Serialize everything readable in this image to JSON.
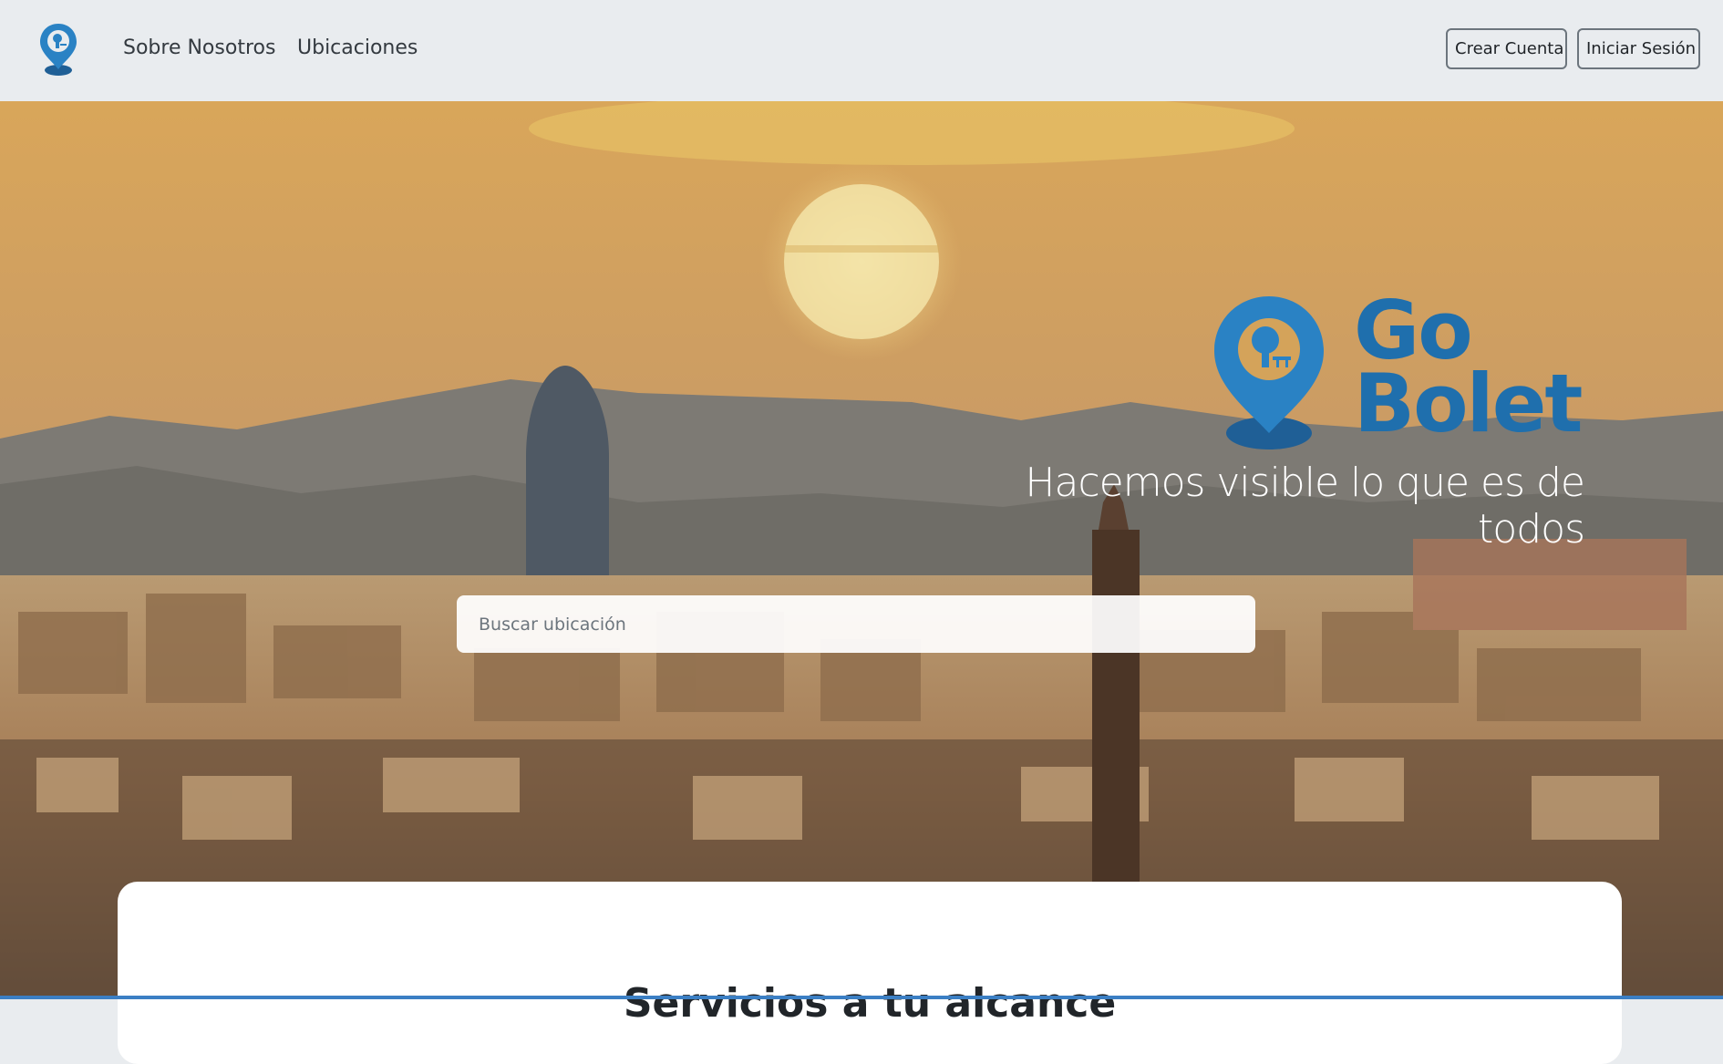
{
  "nav": {
    "logo_icon": "location-pin-icon",
    "links": [
      "Sobre Nosotros",
      "Ubicaciones"
    ],
    "create_account": "Crear Cuenta",
    "login": "Iniciar Sesión"
  },
  "hero": {
    "brand_line1": "Go",
    "brand_line2": "Bolet",
    "tagline": "Hacemos visible lo que es de todos",
    "search_placeholder": "Buscar ubicación"
  },
  "section": {
    "title": "Servicios a tu alcance"
  },
  "colors": {
    "brand_blue": "#1f6fad",
    "navbar_bg": "#e9ecef"
  }
}
